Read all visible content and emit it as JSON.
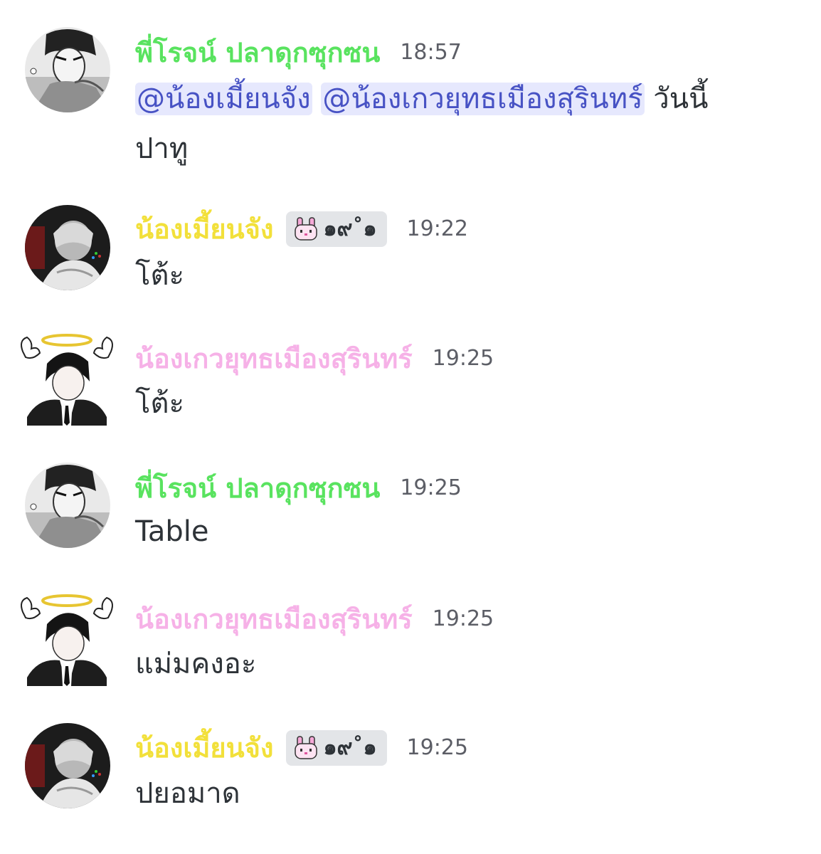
{
  "colors": {
    "user_green": "#59e35f",
    "user_yellow": "#f2e03a",
    "user_pink": "#f6b1e7",
    "mention_text": "#4752c4",
    "mention_bg": "#e6e8fd",
    "timestamp": "#5c5e66",
    "body_text": "#2e3338",
    "badge_bg": "#e3e5e8"
  },
  "messages": [
    {
      "avatar": "manga-avatar-1",
      "username": "พี่โรจน์ ปลาดุกซุกซน",
      "timestamp": "18:57",
      "mentions": [
        "@น้องเมี้ยนจัง",
        "@น้องเกวยุทธเมืองสุรินทร์"
      ],
      "text_after_mentions": "วันนี้",
      "text_line2": "ปาทู"
    },
    {
      "avatar": "manga-avatar-2",
      "username": "น้องเมี้ยนจัง",
      "badge": {
        "icon": "bunny-icon",
        "text": "๑๙˚๑"
      },
      "timestamp": "19:22",
      "text": "โต้ะ"
    },
    {
      "avatar": "angel-avatar",
      "username": "น้องเกวยุทธเมืองสุรินทร์",
      "timestamp": "19:25",
      "text": "โต้ะ"
    },
    {
      "avatar": "manga-avatar-1",
      "username": "พี่โรจน์ ปลาดุกซุกซน",
      "timestamp": "19:25",
      "text": "Table"
    },
    {
      "avatar": "angel-avatar",
      "username": "น้องเกวยุทธเมืองสุรินทร์",
      "timestamp": "19:25",
      "text": "แม่มคงอะ"
    },
    {
      "avatar": "manga-avatar-2",
      "username": "น้องเมี้ยนจัง",
      "badge": {
        "icon": "bunny-icon",
        "text": "๑๙˚๑"
      },
      "timestamp": "19:25",
      "text": "ปยอมาด"
    }
  ]
}
